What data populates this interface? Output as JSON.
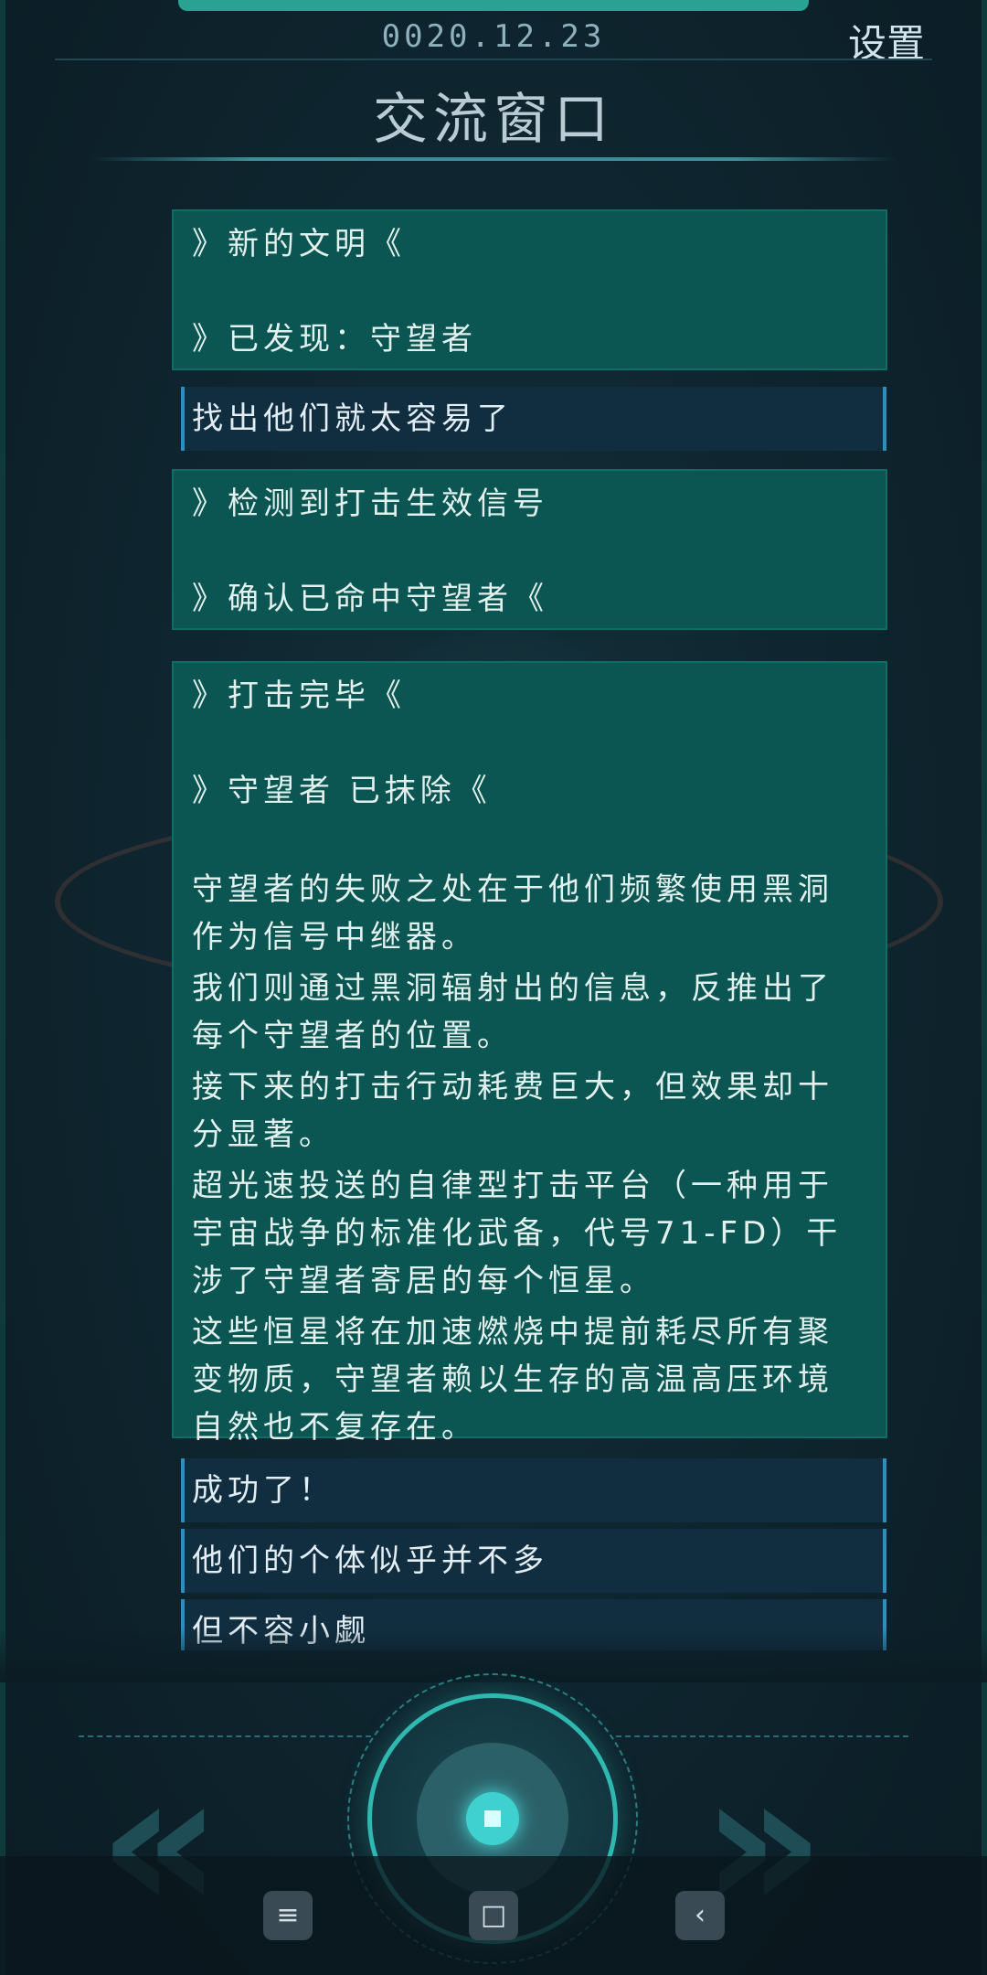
{
  "header": {
    "date": "0020.12.23",
    "settings_label": "设置",
    "title": "交流窗口"
  },
  "messages": [
    {
      "type": "system",
      "lines": [
        "》新的文明《",
        "",
        "》已发现：守望者"
      ]
    },
    {
      "type": "player",
      "text": "找出他们就太容易了"
    },
    {
      "type": "system",
      "lines": [
        "》检测到打击生效信号",
        "",
        "》确认已命中守望者《"
      ]
    },
    {
      "type": "system",
      "lines": [
        "》打击完毕《",
        "",
        "》守望者 已抹除《",
        ""
      ],
      "paragraphs": [
        "守望者的失败之处在于他们频繁使用黑洞作为信号中继器。",
        "我们则通过黑洞辐射出的信息，反推出了每个守望者的位置。",
        "接下来的打击行动耗费巨大，但效果却十分显著。",
        "超光速投送的自律型打击平台（一种用于宇宙战争的标准化武备，代号71-FD）干涉了守望者寄居的每个恒星。",
        "这些恒星将在加速燃烧中提前耗尽所有聚变物质，守望者赖以生存的高温高压环境自然也不复存在。"
      ]
    },
    {
      "type": "player",
      "text": "成功了！"
    },
    {
      "type": "player",
      "text": "他们的个体似乎并不多"
    },
    {
      "type": "player",
      "text": "但不容小觑"
    }
  ],
  "controls": {
    "prev_icon": "double-chevron-left-icon",
    "next_icon": "double-chevron-right-icon",
    "send_icon": "circle-send-icon"
  },
  "navbar": {
    "menu_icon": "≡",
    "home_icon": "□",
    "back_icon": "‹"
  },
  "colors": {
    "system_bubble": "#0b5652",
    "player_bubble": "#112e40",
    "accent": "#2fb8b0"
  }
}
